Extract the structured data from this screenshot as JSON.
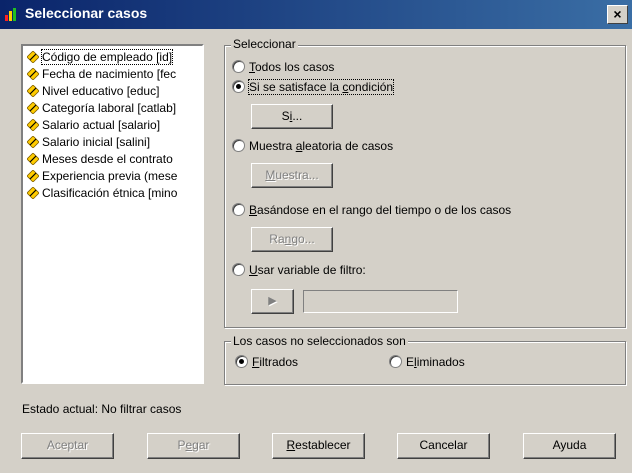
{
  "window": {
    "title": "Seleccionar casos",
    "close_label": "×"
  },
  "variables": [
    "Código de empleado [id]",
    "Fecha de nacimiento [fec",
    "Nivel educativo [educ]",
    "Categoría laboral [catlab]",
    "Salario actual [salario]",
    "Salario inicial [salini]",
    "Meses desde el contrato",
    "Experiencia previa (mese",
    "Clasificación étnica [mino"
  ],
  "seleccionar": {
    "title": "Seleccionar",
    "todos": {
      "ul": "T",
      "rest": "odos los casos"
    },
    "condicion": {
      "pre": "Si se satisface la ",
      "ul": "c",
      "post": "ondición"
    },
    "si_button": {
      "pre": "S",
      "ul": "i",
      "post": "..."
    },
    "muestra_radio": {
      "pre": "Muestra ",
      "ul": "a",
      "post": "leatoria de casos"
    },
    "muestra_button": {
      "ul": "M",
      "post": "uestra..."
    },
    "rango_radio": {
      "ul": "B",
      "post": "asándose en el rango del tiempo o de los casos"
    },
    "rango_button": {
      "pre": "Ra",
      "ul": "n",
      "post": "go..."
    },
    "filtro_radio": {
      "ul": "U",
      "post": "sar variable de filtro:"
    },
    "arrow": "▶"
  },
  "no_seleccionados": {
    "title": "Los casos no seleccionados son",
    "filtrados": {
      "ul": "F",
      "post": "iltrados"
    },
    "eliminados": {
      "pre": "E",
      "ul": "l",
      "post": "iminados"
    }
  },
  "status": "Estado actual: No filtrar casos",
  "buttons": {
    "aceptar": "Aceptar",
    "pegar": {
      "pre": "P",
      "ul": "e",
      "post": "gar"
    },
    "restablecer": {
      "ul": "R",
      "post": "establecer"
    },
    "cancelar": "Cancelar",
    "ayuda": "Ayuda"
  },
  "colors": {
    "titlebar_start": "#0a246a",
    "titlebar_end": "#3a6ea5",
    "dialog_bg": "#d4d0c8",
    "variable_icon": "#ffcc00"
  }
}
